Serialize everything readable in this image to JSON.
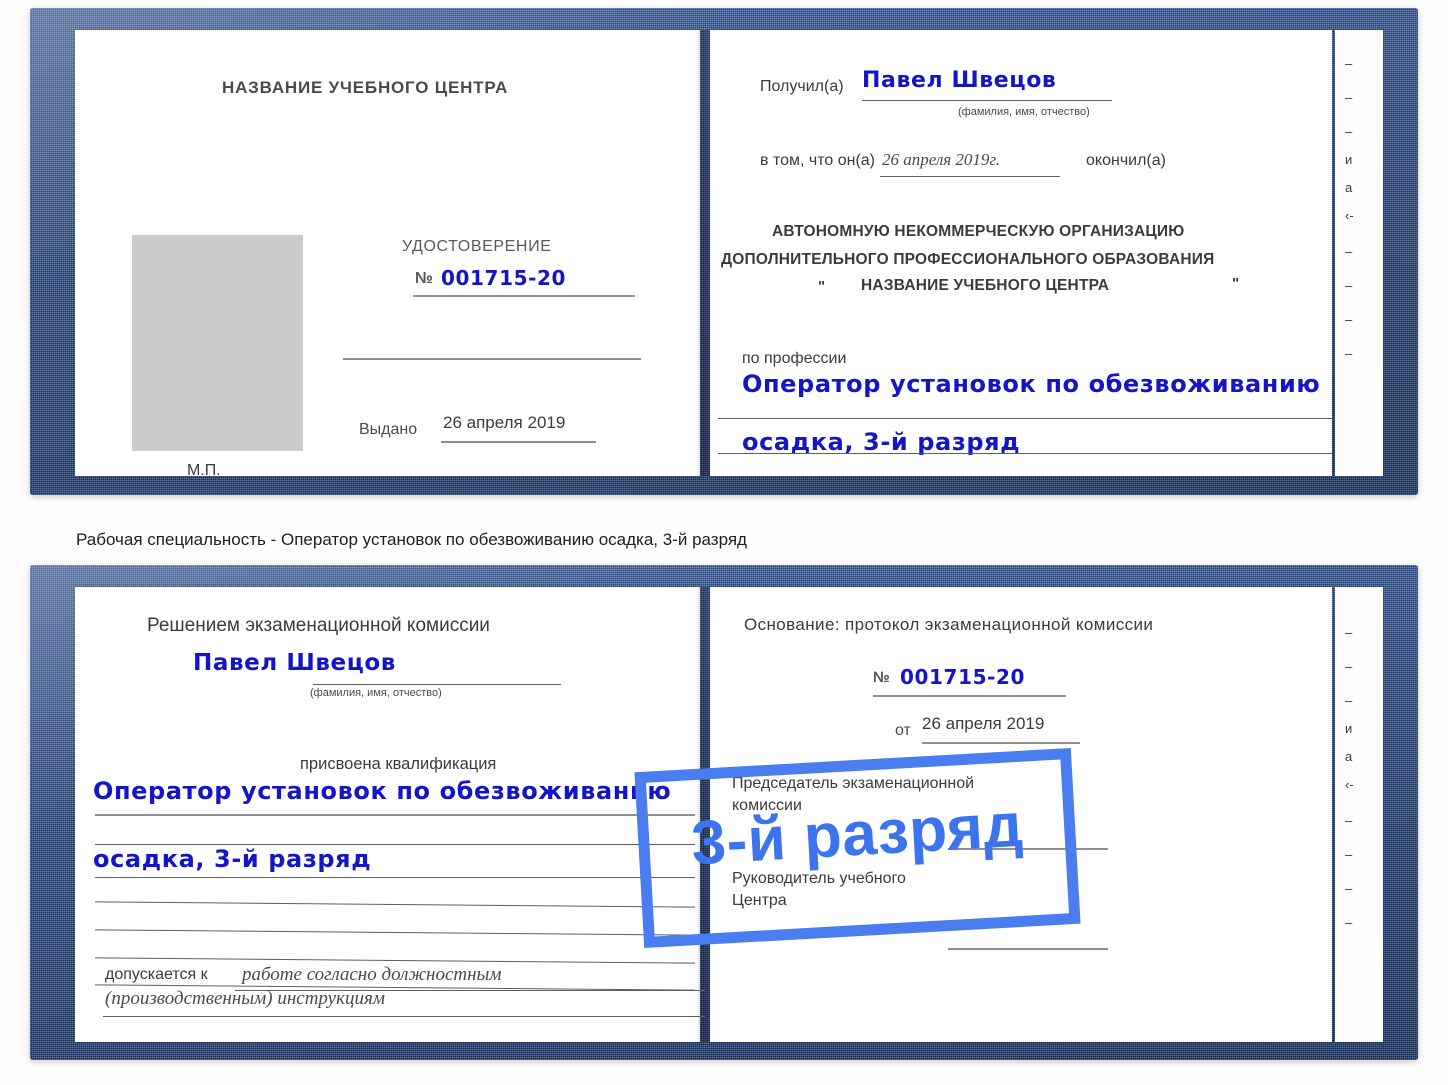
{
  "caption": "Рабочая специальность - Оператор установок по обезвоживанию осадка, 3-й разряд",
  "badge": {
    "label": "3-й разряд",
    "color": "#3d74ee",
    "frame_color": "#4a7ef0"
  },
  "colors": {
    "cover_blue": "#2b4d8e",
    "handwriting_blue": "#1414c8",
    "paper_white": "#ffffff",
    "photo_placeholder_gray": "#cccccc"
  },
  "certificate_top": {
    "left_page": {
      "header": "НАЗВАНИЕ УЧЕБНОГО ЦЕНТРА",
      "doc_type": "УДОСТОВЕРЕНИЕ",
      "number_symbol": "№",
      "number_value": "001715-20",
      "issued_label": "Выдано",
      "issued_value": "26 апреля 2019",
      "seal_label": "М.П."
    },
    "right_page": {
      "received_label": "Получил(а)",
      "received_value": "Павел Швецов",
      "fio_hint": "(фамилия, имя, отчество)",
      "statement_label": "в том, что он(а)",
      "statement_date": "26 апреля 2019г.",
      "statement_tail": "окончил(а)",
      "org_line1": "АВТОНОМНУЮ НЕКОММЕРЧЕСКУЮ ОРГАНИЗАЦИЮ",
      "org_line2": "ДОПОЛНИТЕЛЬНОГО ПРОФЕССИОНАЛЬНОГО ОБРАЗОВАНИЯ",
      "org_quote_open": "\"",
      "org_name": "НАЗВАНИЕ УЧЕБНОГО ЦЕНТРА",
      "org_quote_close": "\"",
      "profession_label": "по профессии",
      "profession_line1": "Оператор установок по обезвоживанию",
      "profession_line2": "осадка, 3-й разряд"
    },
    "edge_fragments": [
      "–",
      "–",
      "–",
      "и",
      "а",
      "‹-",
      "–",
      "–",
      "–",
      "–"
    ]
  },
  "certificate_bottom": {
    "left_page": {
      "header": "Решением экзаменационной комиссии",
      "name_value": "Павел Швецов",
      "fio_hint": "(фамилия, имя, отчество)",
      "qualification_label": "присвоена квалификация",
      "qualification_line1": "Оператор установок по обезвоживанию",
      "qualification_line2": "осадка, 3-й разряд",
      "admitted_label": "допускается к",
      "admitted_line1": "работе согласно должностным",
      "admitted_line2": "(производственным) инструкциям"
    },
    "right_page": {
      "basis_label": "Основание: протокол экзаменационной комиссии",
      "number_symbol": "№",
      "number_value": "001715-20",
      "date_label": "от",
      "date_value": "26 апреля 2019",
      "chair_line1": "Председатель экзаменационной",
      "chair_line2": "комиссии",
      "head_line1": "Руководитель учебного",
      "head_line2": "Центра"
    },
    "edge_fragments": [
      "–",
      "–",
      "–",
      "и",
      "а",
      "‹-",
      "–",
      "–",
      "–",
      "–"
    ]
  }
}
